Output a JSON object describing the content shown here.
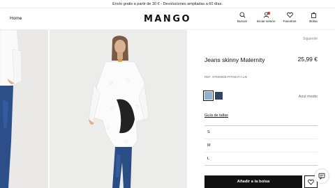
{
  "promo": {
    "text": "Envío gratis a partir de 30 € - Devoluciones ampliadas a 60 días."
  },
  "header": {
    "home_label": "Home",
    "brand": "MANGO",
    "icons": [
      {
        "label": "Buscar",
        "icon": "search-icon"
      },
      {
        "label": "Iniciar sesión",
        "icon": "user-icon"
      },
      {
        "label": "Favoritos",
        "icon": "heart-icon"
      },
      {
        "label": "Bolsa",
        "icon": "bag-icon"
      }
    ]
  },
  "product": {
    "next_label": "Siguiente",
    "name": "Jeans skinny Maternity",
    "price": "25,99 €",
    "reference": "REF. 97505009-PITIMAT-I-LM",
    "color_name": "Azul medio",
    "colors": [
      "#8fb2cf",
      "#2e4563"
    ],
    "selected_color_index": 0,
    "size_guide_label": "Guía de tallas",
    "sizes": [
      "S",
      "M",
      "L"
    ],
    "add_to_bag_label": "Añadir a la bolsa"
  },
  "colors": {
    "accent": "#111111",
    "notification": "#e03030"
  }
}
